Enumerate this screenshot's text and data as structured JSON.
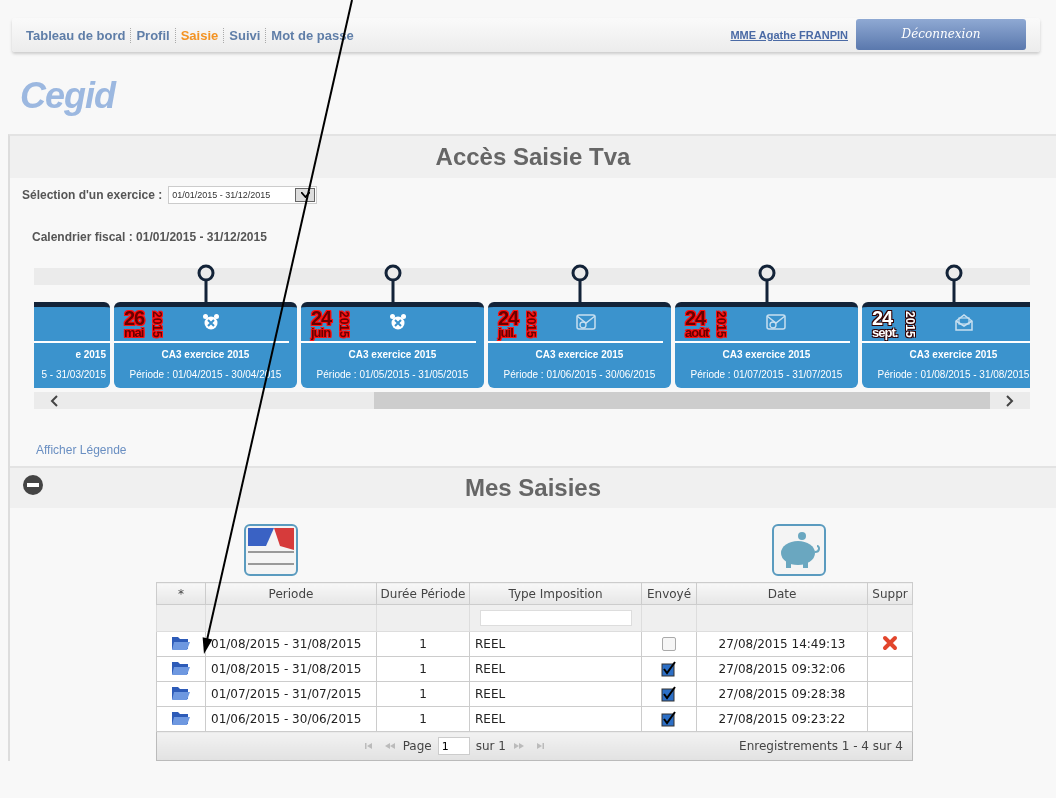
{
  "nav": {
    "items": [
      {
        "label": "Tableau de bord",
        "selected": false
      },
      {
        "label": "Profil",
        "selected": false
      },
      {
        "label": "Saisie",
        "selected": true
      },
      {
        "label": "Suivi",
        "selected": false
      },
      {
        "label": "Mot de passe",
        "selected": false
      }
    ],
    "user": "MME Agathe FRANPIN",
    "logout": "Déconnexion"
  },
  "logo": "Cegid",
  "access": {
    "title": "Accès Saisie Tva",
    "select_label": "Sélection d'un exercice :",
    "select_value": "01/01/2015 - 31/12/2015",
    "calendar": "Calendrier fiscal : 01/01/2015 - 31/12/2015",
    "partial_card": {
      "title": "e 2015",
      "period": "5 - 31/03/2015"
    },
    "cards": [
      {
        "day": "26",
        "month": "mai",
        "year": "2015",
        "overdue": true,
        "kind": "alarm",
        "title": "CA3 exercice 2015",
        "period": "Période : 01/04/2015 - 30/04/2015"
      },
      {
        "day": "24",
        "month": "juin",
        "year": "2015",
        "overdue": true,
        "kind": "alarm",
        "title": "CA3 exercice 2015",
        "period": "Période : 01/05/2015 - 31/05/2015"
      },
      {
        "day": "24",
        "month": "juil.",
        "year": "2015",
        "overdue": true,
        "kind": "mail",
        "title": "CA3 exercice 2015",
        "period": "Période : 01/06/2015 - 30/06/2015"
      },
      {
        "day": "24",
        "month": "août",
        "year": "2015",
        "overdue": true,
        "kind": "mail",
        "title": "CA3 exercice 2015",
        "period": "Période : 01/07/2015 - 31/07/2015"
      },
      {
        "day": "24",
        "month": "sept.",
        "year": "2015",
        "overdue": false,
        "kind": "envelope",
        "title": "CA3 exercice 2015",
        "period": "Période : 01/08/2015 - 31/08/2015"
      }
    ],
    "legend": "Afficher Légende"
  },
  "saisies": {
    "title": "Mes Saisies",
    "columns": [
      "*",
      "Periode",
      "Durée Période",
      "Type Imposition",
      "Envoyé",
      "Date",
      "Suppr"
    ],
    "rows": [
      {
        "period": "01/08/2015 - 31/08/2015",
        "duration": "1",
        "type": "REEL",
        "sent": false,
        "date": "27/08/2015 14:49:13",
        "deletable": true
      },
      {
        "period": "01/08/2015 - 31/08/2015",
        "duration": "1",
        "type": "REEL",
        "sent": true,
        "date": "27/08/2015 09:32:06",
        "deletable": false
      },
      {
        "period": "01/07/2015 - 31/07/2015",
        "duration": "1",
        "type": "REEL",
        "sent": true,
        "date": "27/08/2015 09:28:38",
        "deletable": false
      },
      {
        "period": "01/06/2015 - 30/06/2015",
        "duration": "1",
        "type": "REEL",
        "sent": true,
        "date": "27/08/2015 09:23:22",
        "deletable": false
      }
    ],
    "pager": {
      "page_label": "Page",
      "page": "1",
      "of": "sur 1",
      "records": "Enregistrements 1 - 4 sur 4"
    }
  }
}
